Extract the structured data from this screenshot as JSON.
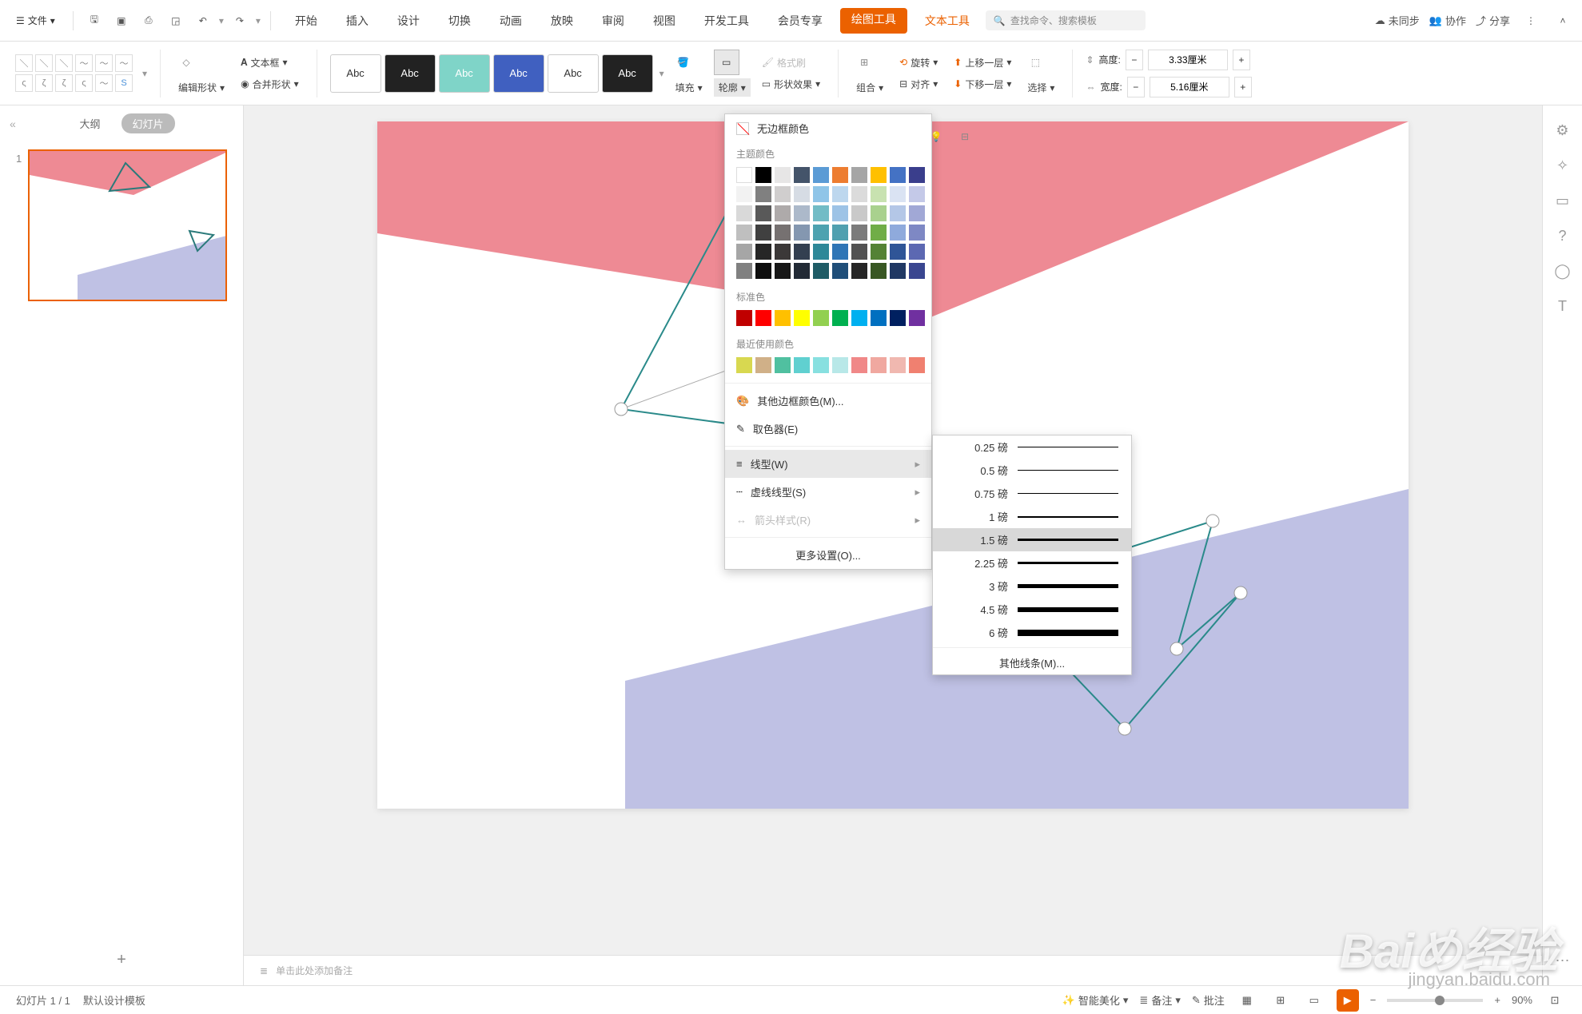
{
  "topbar": {
    "file": "文件",
    "tabs": [
      "开始",
      "插入",
      "设计",
      "切换",
      "动画",
      "放映",
      "审阅",
      "视图",
      "开发工具",
      "会员专享"
    ],
    "tool_tab": "绘图工具",
    "text_tab": "文本工具",
    "search_placeholder": "查找命令、搜索模板",
    "unsync": "未同步",
    "collab": "协作",
    "share": "分享"
  },
  "ribbon": {
    "edit_shape": "编辑形状",
    "textbox": "文本框",
    "merge_shape": "合并形状",
    "abc": "Abc",
    "fill": "填充",
    "outline": "轮廓",
    "shape_effect": "形状效果",
    "format_painter": "格式刷",
    "group": "组合",
    "rotate": "旋转",
    "align": "对齐",
    "bring_forward": "上移一层",
    "send_backward": "下移一层",
    "select": "选择",
    "height_label": "高度:",
    "height_value": "3.33厘米",
    "width_label": "宽度:",
    "width_value": "5.16厘米"
  },
  "panel": {
    "outline_tab": "大纲",
    "slides_tab": "幻灯片",
    "slide_num": "1"
  },
  "dropdown": {
    "no_border": "无边框颜色",
    "theme_colors": "主题颜色",
    "standard_colors": "标准色",
    "recent_colors": "最近使用颜色",
    "more_border": "其他边框颜色(M)...",
    "eyedropper": "取色器(E)",
    "line_type": "线型(W)",
    "dash_type": "虚线线型(S)",
    "arrow_style": "箭头样式(R)",
    "more_settings": "更多设置(O)..."
  },
  "weights": {
    "items": [
      "0.25 磅",
      "0.5 磅",
      "0.75 磅",
      "1 磅",
      "1.5 磅",
      "2.25 磅",
      "3 磅",
      "4.5 磅",
      "6 磅"
    ],
    "more_lines": "其他线条(M)..."
  },
  "notes": {
    "placeholder": "单击此处添加备注"
  },
  "status": {
    "slide_count": "幻灯片 1 / 1",
    "template": "默认设计模板",
    "beautify": "智能美化",
    "notes_btn": "备注",
    "comment": "批注",
    "zoom": "90%"
  },
  "watermark": {
    "main": "Baiめ经验",
    "sub": "jingyan.baidu.com"
  },
  "colors": {
    "theme_row1": [
      "#ffffff",
      "#000000",
      "#e7e6e6",
      "#44546a",
      "#5b9bd5",
      "#ed7d31",
      "#a5a5a5",
      "#ffc000",
      "#4472c4",
      "#3a3e8c"
    ],
    "theme_shades": [
      [
        "#f2f2f2",
        "#808080",
        "#d0cece",
        "#d6dce4",
        "#8fc5e8",
        "#bdd7ee",
        "#dbdbdb",
        "#c8e2b0",
        "#dae3f3",
        "#c4c9e8"
      ],
      [
        "#d9d9d9",
        "#595959",
        "#aeaaaa",
        "#acb9ca",
        "#72bcc6",
        "#9dc3e6",
        "#c9c9c9",
        "#a9d18e",
        "#b4c7e7",
        "#a1a8d6"
      ],
      [
        "#bfbfbf",
        "#404040",
        "#767171",
        "#8497b0",
        "#4da2b0",
        "#50a0b0",
        "#7b7b7b",
        "#70ad47",
        "#8faadc",
        "#7e88c4"
      ],
      [
        "#a6a6a6",
        "#262626",
        "#3b3838",
        "#333f50",
        "#2e8898",
        "#2e75b6",
        "#525252",
        "#548235",
        "#2f5597",
        "#5c68b2"
      ],
      [
        "#808080",
        "#0d0d0d",
        "#171717",
        "#222a35",
        "#1f5c66",
        "#1f4e79",
        "#262626",
        "#385723",
        "#203864",
        "#3a4690"
      ]
    ],
    "standard": [
      "#c00000",
      "#ff0000",
      "#ffc000",
      "#ffff00",
      "#92d050",
      "#00b050",
      "#00b0f0",
      "#0070c0",
      "#002060",
      "#7030a0"
    ],
    "recent": [
      "#d8d850",
      "#d0b088",
      "#50c0a0",
      "#60d0d0",
      "#88e0e0",
      "#b8e8e8",
      "#f08888",
      "#f0a8a0",
      "#f0b8b0",
      "#f08070"
    ]
  }
}
